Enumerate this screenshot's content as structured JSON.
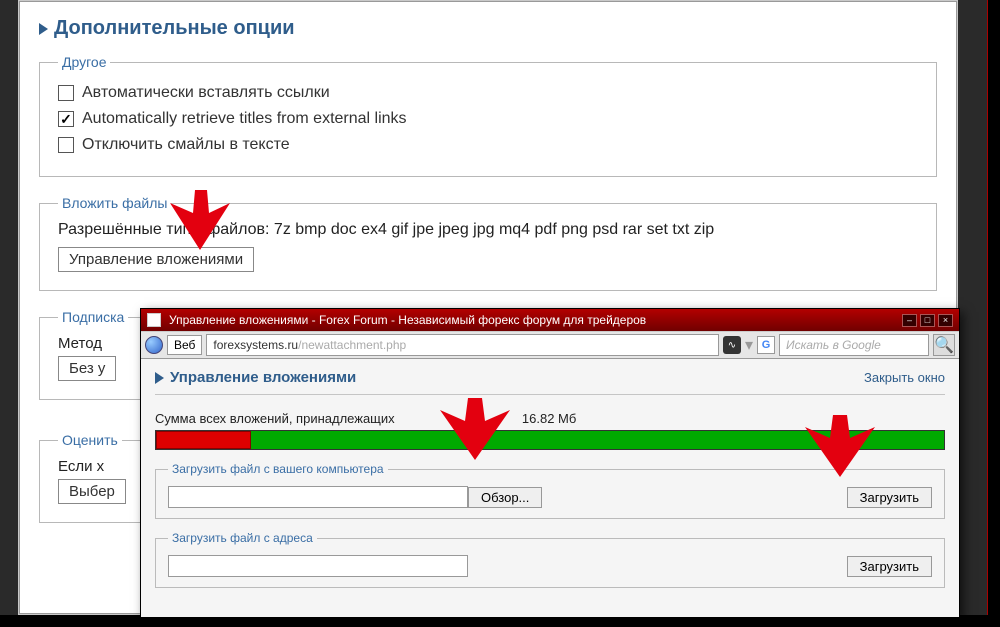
{
  "section_title": "Дополнительные опции",
  "fieldsets": {
    "other": {
      "legend": "Другое",
      "options": [
        {
          "label": "Автоматически вставлять ссылки",
          "checked": false
        },
        {
          "label": "Automatically retrieve titles from external links",
          "checked": true
        },
        {
          "label": "Отключить смайлы в тексте",
          "checked": false
        }
      ]
    },
    "attach": {
      "legend": "Вложить файлы",
      "allowed_types": "Разрешённые типы файлов: 7z bmp doc ex4 gif jpe jpeg jpg mq4 pdf png psd rar set txt zip",
      "manage_button": "Управление вложениями"
    },
    "subscribe": {
      "legend": "Подписка",
      "method_label": "Метод",
      "select_value": "Без у"
    },
    "rate": {
      "legend": "Оценить",
      "if_label": "Если х",
      "select_value": "Выбер"
    }
  },
  "popup": {
    "window_title": "Управление вложениями - Forex Forum - Независимый форекс форум для трейдеров",
    "addr": {
      "web_button": "Веб",
      "url_main": "forexsystems.ru",
      "url_path": "/newattachment.php",
      "search_placeholder": "Искать в Google"
    },
    "body": {
      "title": "Управление вложениями",
      "close": "Закрыть окно",
      "quota_label": "Сумма всех вложений, принадлежащих",
      "quota_value": "16.82 Мб",
      "upload_pc_legend": "Загрузить файл с вашего компьютера",
      "browse_label": "Обзор...",
      "upload_button": "Загрузить",
      "upload_url_legend": "Загрузить файл с адреса"
    }
  }
}
